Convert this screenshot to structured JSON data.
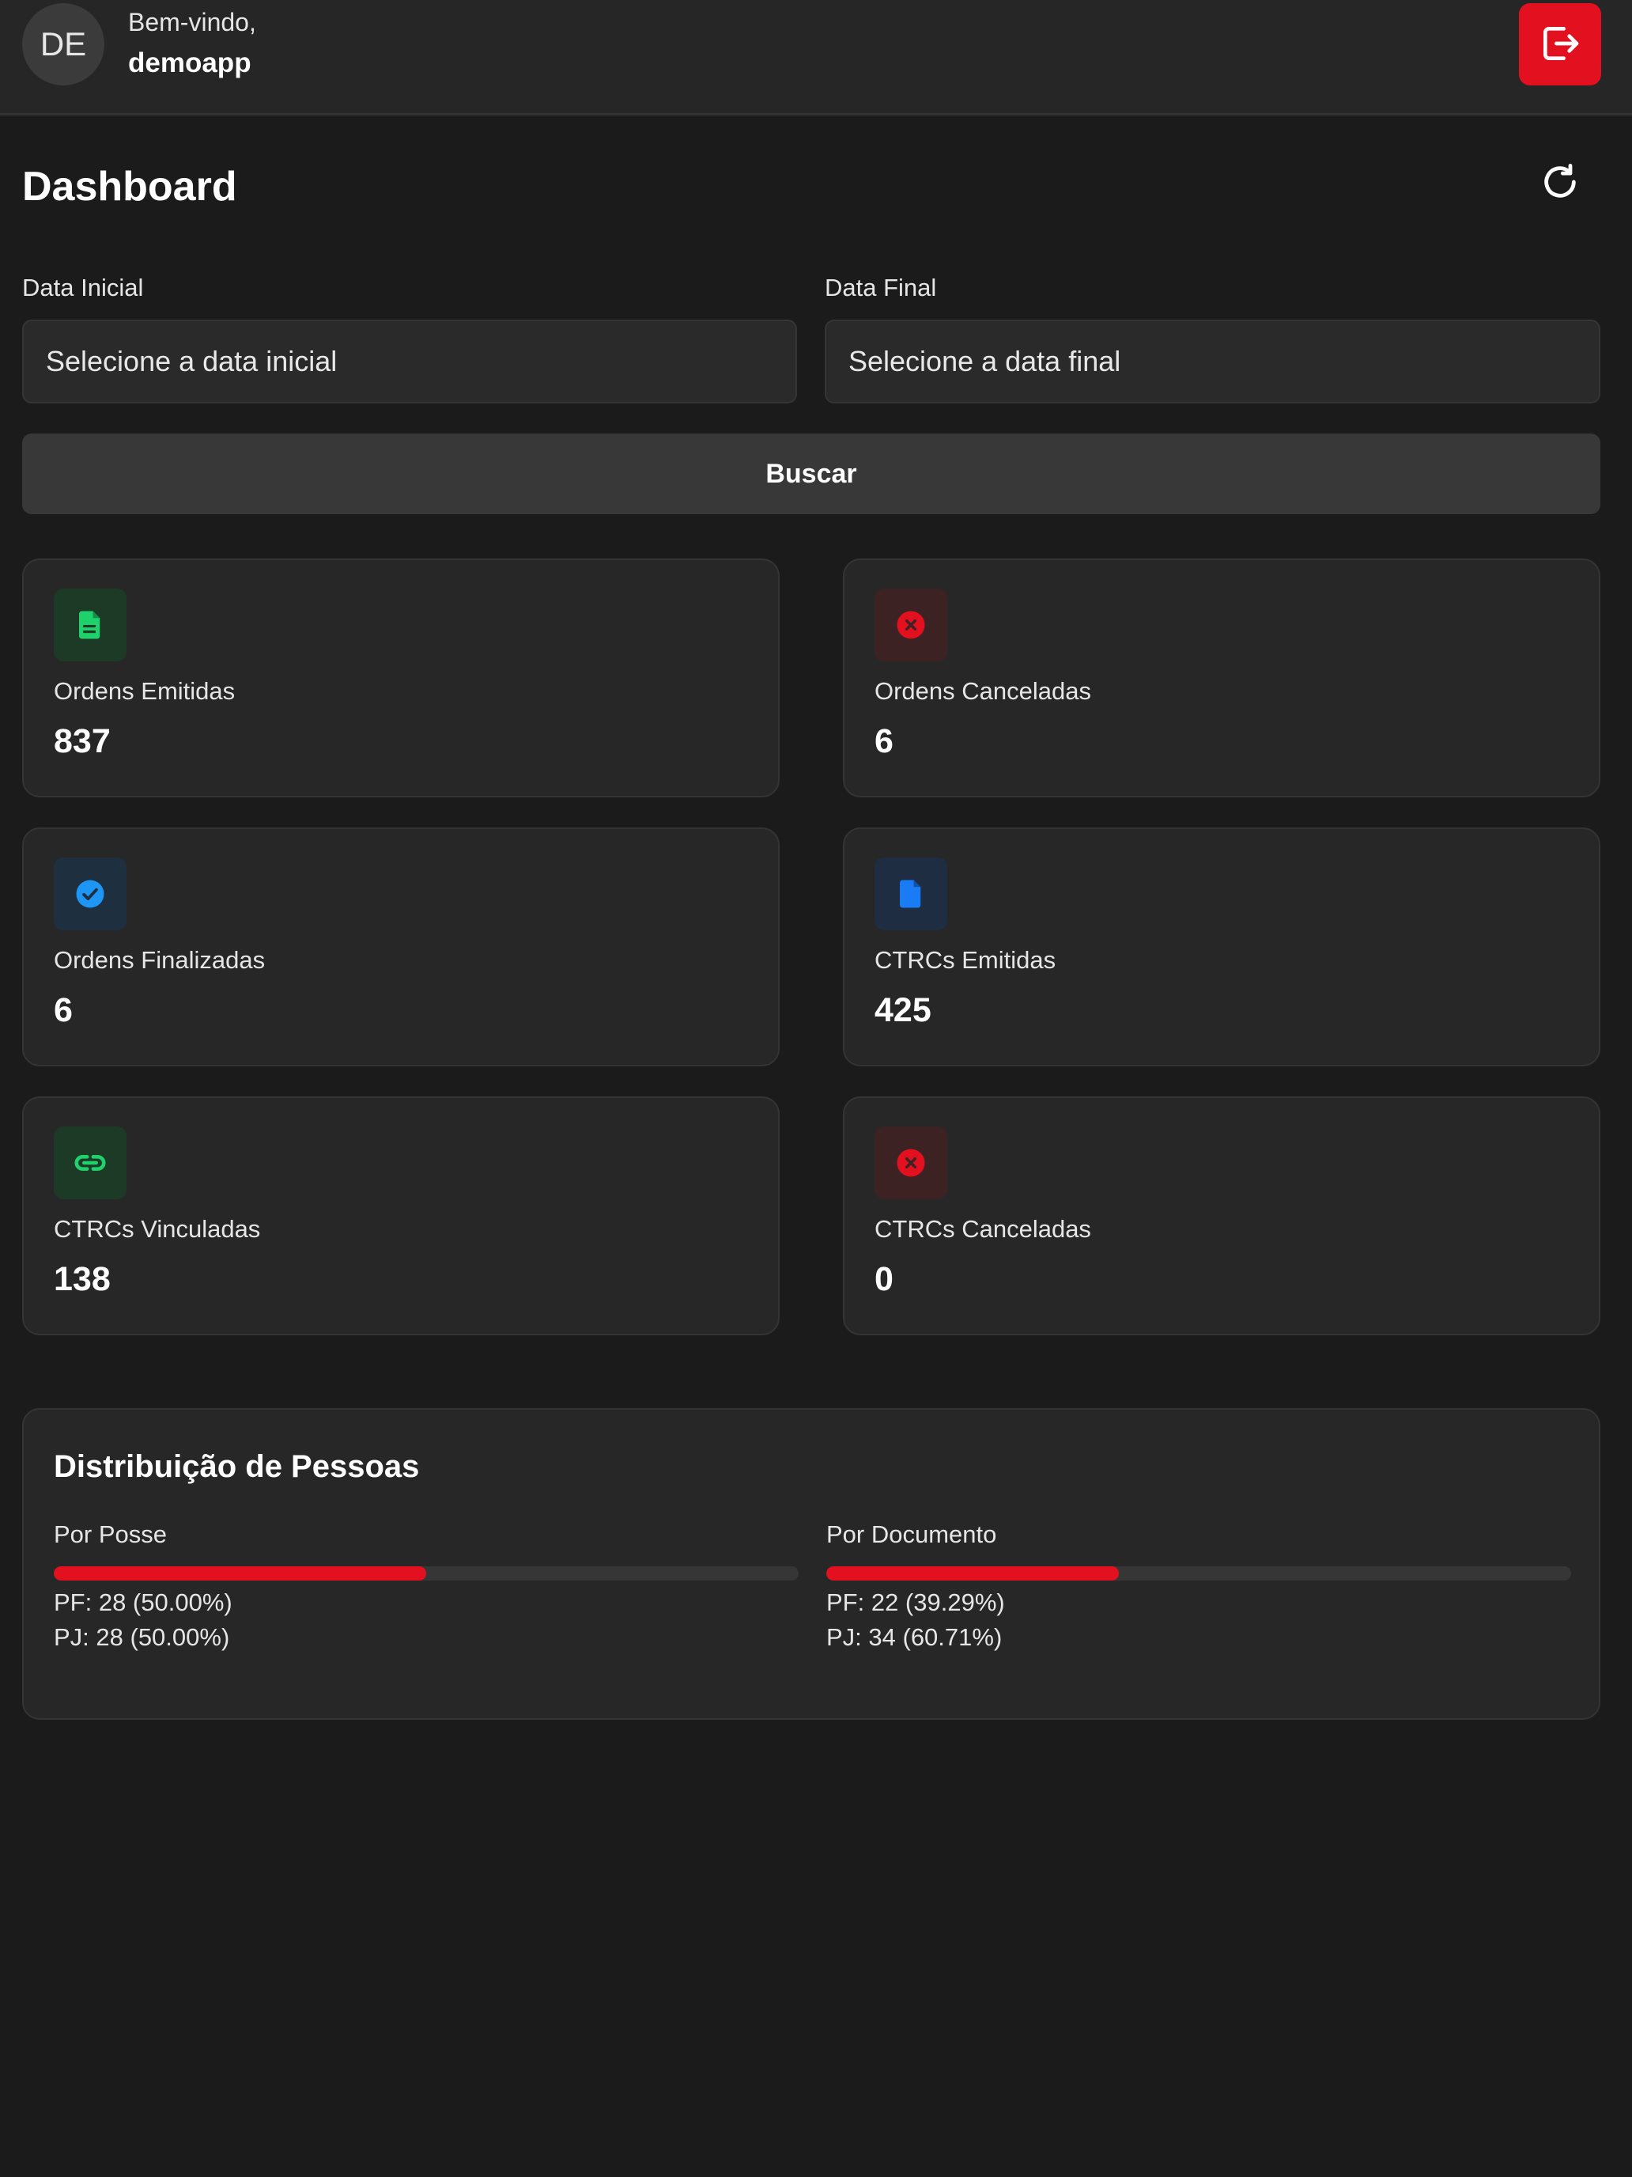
{
  "header": {
    "avatar_initials": "DE",
    "welcome": "Bem-vindo,",
    "username": "demoapp",
    "logout_icon": "logout-icon",
    "logout_color": "#e3101f"
  },
  "dashboard": {
    "title": "Dashboard",
    "refresh_icon": "refresh-icon"
  },
  "filters": {
    "start_label": "Data Inicial",
    "start_placeholder": "Selecione a data inicial",
    "end_label": "Data Final",
    "end_placeholder": "Selecione a data final",
    "search_label": "Buscar"
  },
  "stats": [
    {
      "label": "Ordens Emitidas",
      "value": "837",
      "icon": "document-icon",
      "color": "#1fd16a"
    },
    {
      "label": "Ordens Canceladas",
      "value": "6",
      "icon": "cancel-icon",
      "color": "#e3101f"
    },
    {
      "label": "Ordens Finalizadas",
      "value": "6",
      "icon": "check-circle-icon",
      "color": "#1e96f5"
    },
    {
      "label": "CTRCs Emitidas",
      "value": "425",
      "icon": "file-icon",
      "color": "#1a7cf5"
    },
    {
      "label": "CTRCs Vinculadas",
      "value": "138",
      "icon": "link-icon",
      "color": "#1fd16a"
    },
    {
      "label": "CTRCs Canceladas",
      "value": "0",
      "icon": "cancel-icon",
      "color": "#e3101f"
    }
  ],
  "distribution": {
    "title": "Distribuição de Pessoas",
    "by_possession": {
      "label": "Por Posse",
      "pf": "PF: 28 (50.00%)",
      "pj": "PJ: 28 (50.00%)",
      "pf_share": 0.5
    },
    "by_document": {
      "label": "Por Documento",
      "pf": "PF: 22 (39.29%)",
      "pj": "PJ: 34 (60.71%)",
      "pf_share": 0.3929
    },
    "bar_color": "#e3101f"
  }
}
